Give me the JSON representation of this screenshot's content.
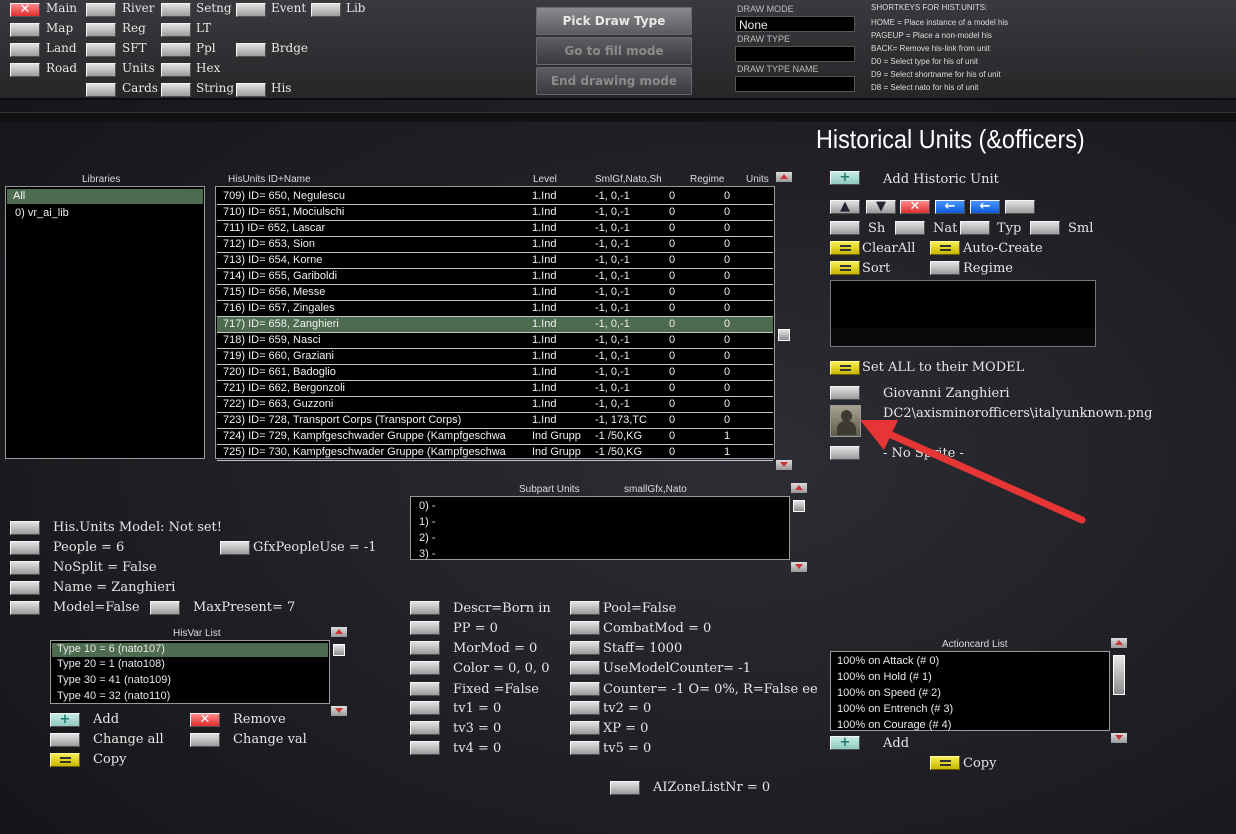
{
  "topbar": {
    "col1": [
      "Main",
      "Map",
      "Land",
      "Road"
    ],
    "col2": [
      "River",
      "Reg",
      "SFT",
      "Units",
      "Cards"
    ],
    "col3": [
      "Setng",
      "LT",
      "Ppl",
      "Hex",
      "String"
    ],
    "col4": [
      "Event",
      "Brdge",
      "His"
    ],
    "col5": [
      "Lib"
    ],
    "pick_draw_type": "Pick Draw Type",
    "goto_fill_mode": "Go to fill mode",
    "end_drawing_mode": "End drawing mode",
    "draw_mode_label": "DRAW MODE",
    "draw_mode_value": "None",
    "draw_type_label": "DRAW TYPE",
    "draw_type_name_label": "DRAW TYPE NAME",
    "shortkeys_title": "SHORTKEYS FOR HIST.UNITS:",
    "shortkeys": [
      "HOME = Place instance of a model his",
      "PAGEUP = Place a non-model his",
      "BACK= Remove his-link from unit",
      "D0 = Select type for his of unit",
      "D9 = Select shortname for his of unit",
      "D8 = Select nato for his of unit"
    ]
  },
  "title": "Historical Units (&officers)",
  "libraries": {
    "header": "Libraries",
    "items": [
      "All",
      "0) vr_ai_lib"
    ]
  },
  "hisunits": {
    "headers": [
      "HisUnits ID+Name",
      "Level",
      "SmlGf,Nato,Sh",
      "Regime",
      "Units"
    ],
    "rows": [
      {
        "name": "709) ID= 650, Negulescu",
        "level": "1.Ind",
        "sml": "-1, 0,-1",
        "regime": "0",
        "units": "0"
      },
      {
        "name": "710) ID= 651, Mociulschi",
        "level": "1.Ind",
        "sml": "-1, 0,-1",
        "regime": "0",
        "units": "0"
      },
      {
        "name": "711) ID= 652, Lascar",
        "level": "1.Ind",
        "sml": "-1, 0,-1",
        "regime": "0",
        "units": "0"
      },
      {
        "name": "712) ID= 653, Sion",
        "level": "1.Ind",
        "sml": "-1, 0,-1",
        "regime": "0",
        "units": "0"
      },
      {
        "name": "713) ID= 654, Korne",
        "level": "1.Ind",
        "sml": "-1, 0,-1",
        "regime": "0",
        "units": "0"
      },
      {
        "name": "714) ID= 655, Gariboldi",
        "level": "1.Ind",
        "sml": "-1, 0,-1",
        "regime": "0",
        "units": "0"
      },
      {
        "name": "715) ID= 656, Messe",
        "level": "1.Ind",
        "sml": "-1, 0,-1",
        "regime": "0",
        "units": "0"
      },
      {
        "name": "716) ID= 657, Zingales",
        "level": "1.Ind",
        "sml": "-1, 0,-1",
        "regime": "0",
        "units": "0"
      },
      {
        "name": "717) ID= 658, Zanghieri",
        "level": "1.Ind",
        "sml": "-1, 0,-1",
        "regime": "0",
        "units": "0"
      },
      {
        "name": "718) ID= 659, Nasci",
        "level": "1.Ind",
        "sml": "-1, 0,-1",
        "regime": "0",
        "units": "0"
      },
      {
        "name": "719) ID= 660, Graziani",
        "level": "1.Ind",
        "sml": "-1, 0,-1",
        "regime": "0",
        "units": "0"
      },
      {
        "name": "720) ID= 661, Badoglio",
        "level": "1.Ind",
        "sml": "-1, 0,-1",
        "regime": "0",
        "units": "0"
      },
      {
        "name": "721) ID= 662, Bergonzoli",
        "level": "1.Ind",
        "sml": "-1, 0,-1",
        "regime": "0",
        "units": "0"
      },
      {
        "name": "722) ID= 663, Guzzoni",
        "level": "1.Ind",
        "sml": "-1, 0,-1",
        "regime": "0",
        "units": "0"
      },
      {
        "name": "723) ID= 728, Transport Corps (Transport Corps)",
        "level": "1.Ind",
        "sml": "-1, 173,TC",
        "regime": "0",
        "units": "0"
      },
      {
        "name": "724) ID= 729, Kampfgeschwader Gruppe (Kampfgeschwa",
        "level": "Ind Grupp",
        "sml": "-1 /50,KG",
        "regime": "0",
        "units": "1"
      },
      {
        "name": "725) ID= 730, Kampfgeschwader Gruppe (Kampfgeschwa",
        "level": "Ind Grupp",
        "sml": "-1 /50,KG",
        "regime": "0",
        "units": "1"
      }
    ],
    "selected_index": 8
  },
  "right": {
    "add_historic_unit": "Add Historic Unit",
    "sh": "Sh",
    "nat": "Nat",
    "typ": "Typ",
    "sml": "Sml",
    "clear_all": "ClearAll",
    "auto_create": "Auto-Create",
    "sort": "Sort",
    "regime": "Regime",
    "set_all_model": "Set ALL to their MODEL",
    "officer_name": "Giovanni Zanghieri",
    "officer_image": "DC2\\axisminorofficers\\italyunknown.png",
    "sprite": "- No Sprite -"
  },
  "subpart": {
    "header": "Subpart Units",
    "header2": "smallGfx,Nato",
    "rows": [
      "0)  -",
      "1)  -",
      "2)  -",
      "3)  -"
    ]
  },
  "props_left": [
    "His.Units Model: Not set!",
    "People = 6",
    "NoSplit = False",
    "Name = Zanghieri",
    "Model=False"
  ],
  "gfx_people_use": "GfxPeopleUse = -1",
  "max_present": "MaxPresent= 7",
  "hisvar": {
    "header": "HisVar List",
    "rows": [
      "Type 10 = 6 (nato107)",
      "Type 20 = 1 (nato108)",
      "Type 30 = 41 (nato109)",
      "Type 40 = 32 (nato110)"
    ],
    "add": "Add",
    "remove": "Remove",
    "change_all": "Change all",
    "change_val": "Change val",
    "copy": "Copy"
  },
  "props_mid": [
    "Descr=Born in",
    "PP =  0",
    "MorMod =  0",
    "Color =  0, 0, 0",
    "Fixed =False",
    "tv1 =  0",
    "tv3 =  0",
    "tv4 =  0"
  ],
  "props_mid2": [
    "Pool=False",
    "CombatMod =  0",
    "Staff=  1000",
    "UseModelCounter= -1",
    "Counter= -1 O=  0%, R=False  ee",
    "tv2 =  0",
    "XP =  0",
    "tv5 =  0"
  ],
  "ai_zone": "AIZoneListNr = 0",
  "actioncard": {
    "header": "Actioncard List",
    "rows": [
      "100% on Attack (# 0)",
      "100% on Hold (# 1)",
      "100% on Speed (# 2)",
      "100% on Entrench (# 3)",
      "100% on Courage (# 4)"
    ],
    "add": "Add",
    "copy": "Copy"
  },
  "colors": {
    "arrow": "#e53535",
    "selected_row": "#4d6b4f",
    "accent_yellow": "#e8dc20"
  }
}
